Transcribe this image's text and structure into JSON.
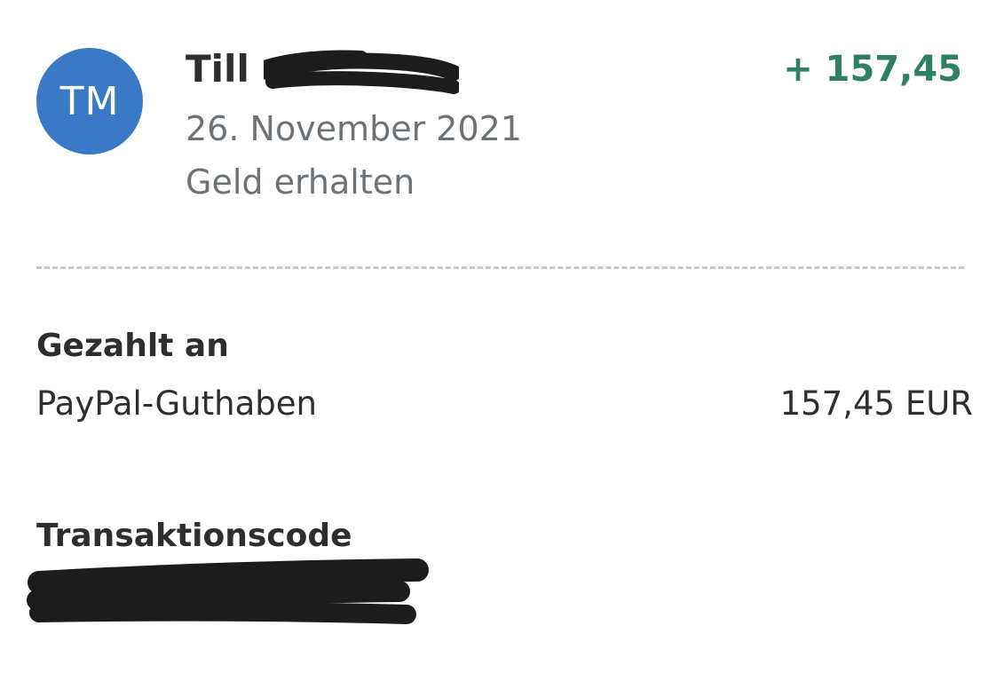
{
  "transaction": {
    "avatar_initials": "TM",
    "name_visible": "Till",
    "amount_display": "+ 157,45",
    "date": "26. November 2021",
    "type": "Geld erhalten"
  },
  "paid_to": {
    "heading": "Gezahlt an",
    "source": "PayPal-Guthaben",
    "amount": "157,45 EUR"
  },
  "transaction_code": {
    "heading": "Transaktionscode"
  },
  "colors": {
    "avatar_bg": "#3a79c6",
    "amount_green": "#2f8062",
    "primary_text": "#2c2e2f",
    "secondary_text": "#6c7378",
    "redaction": "#1c1c1c"
  }
}
